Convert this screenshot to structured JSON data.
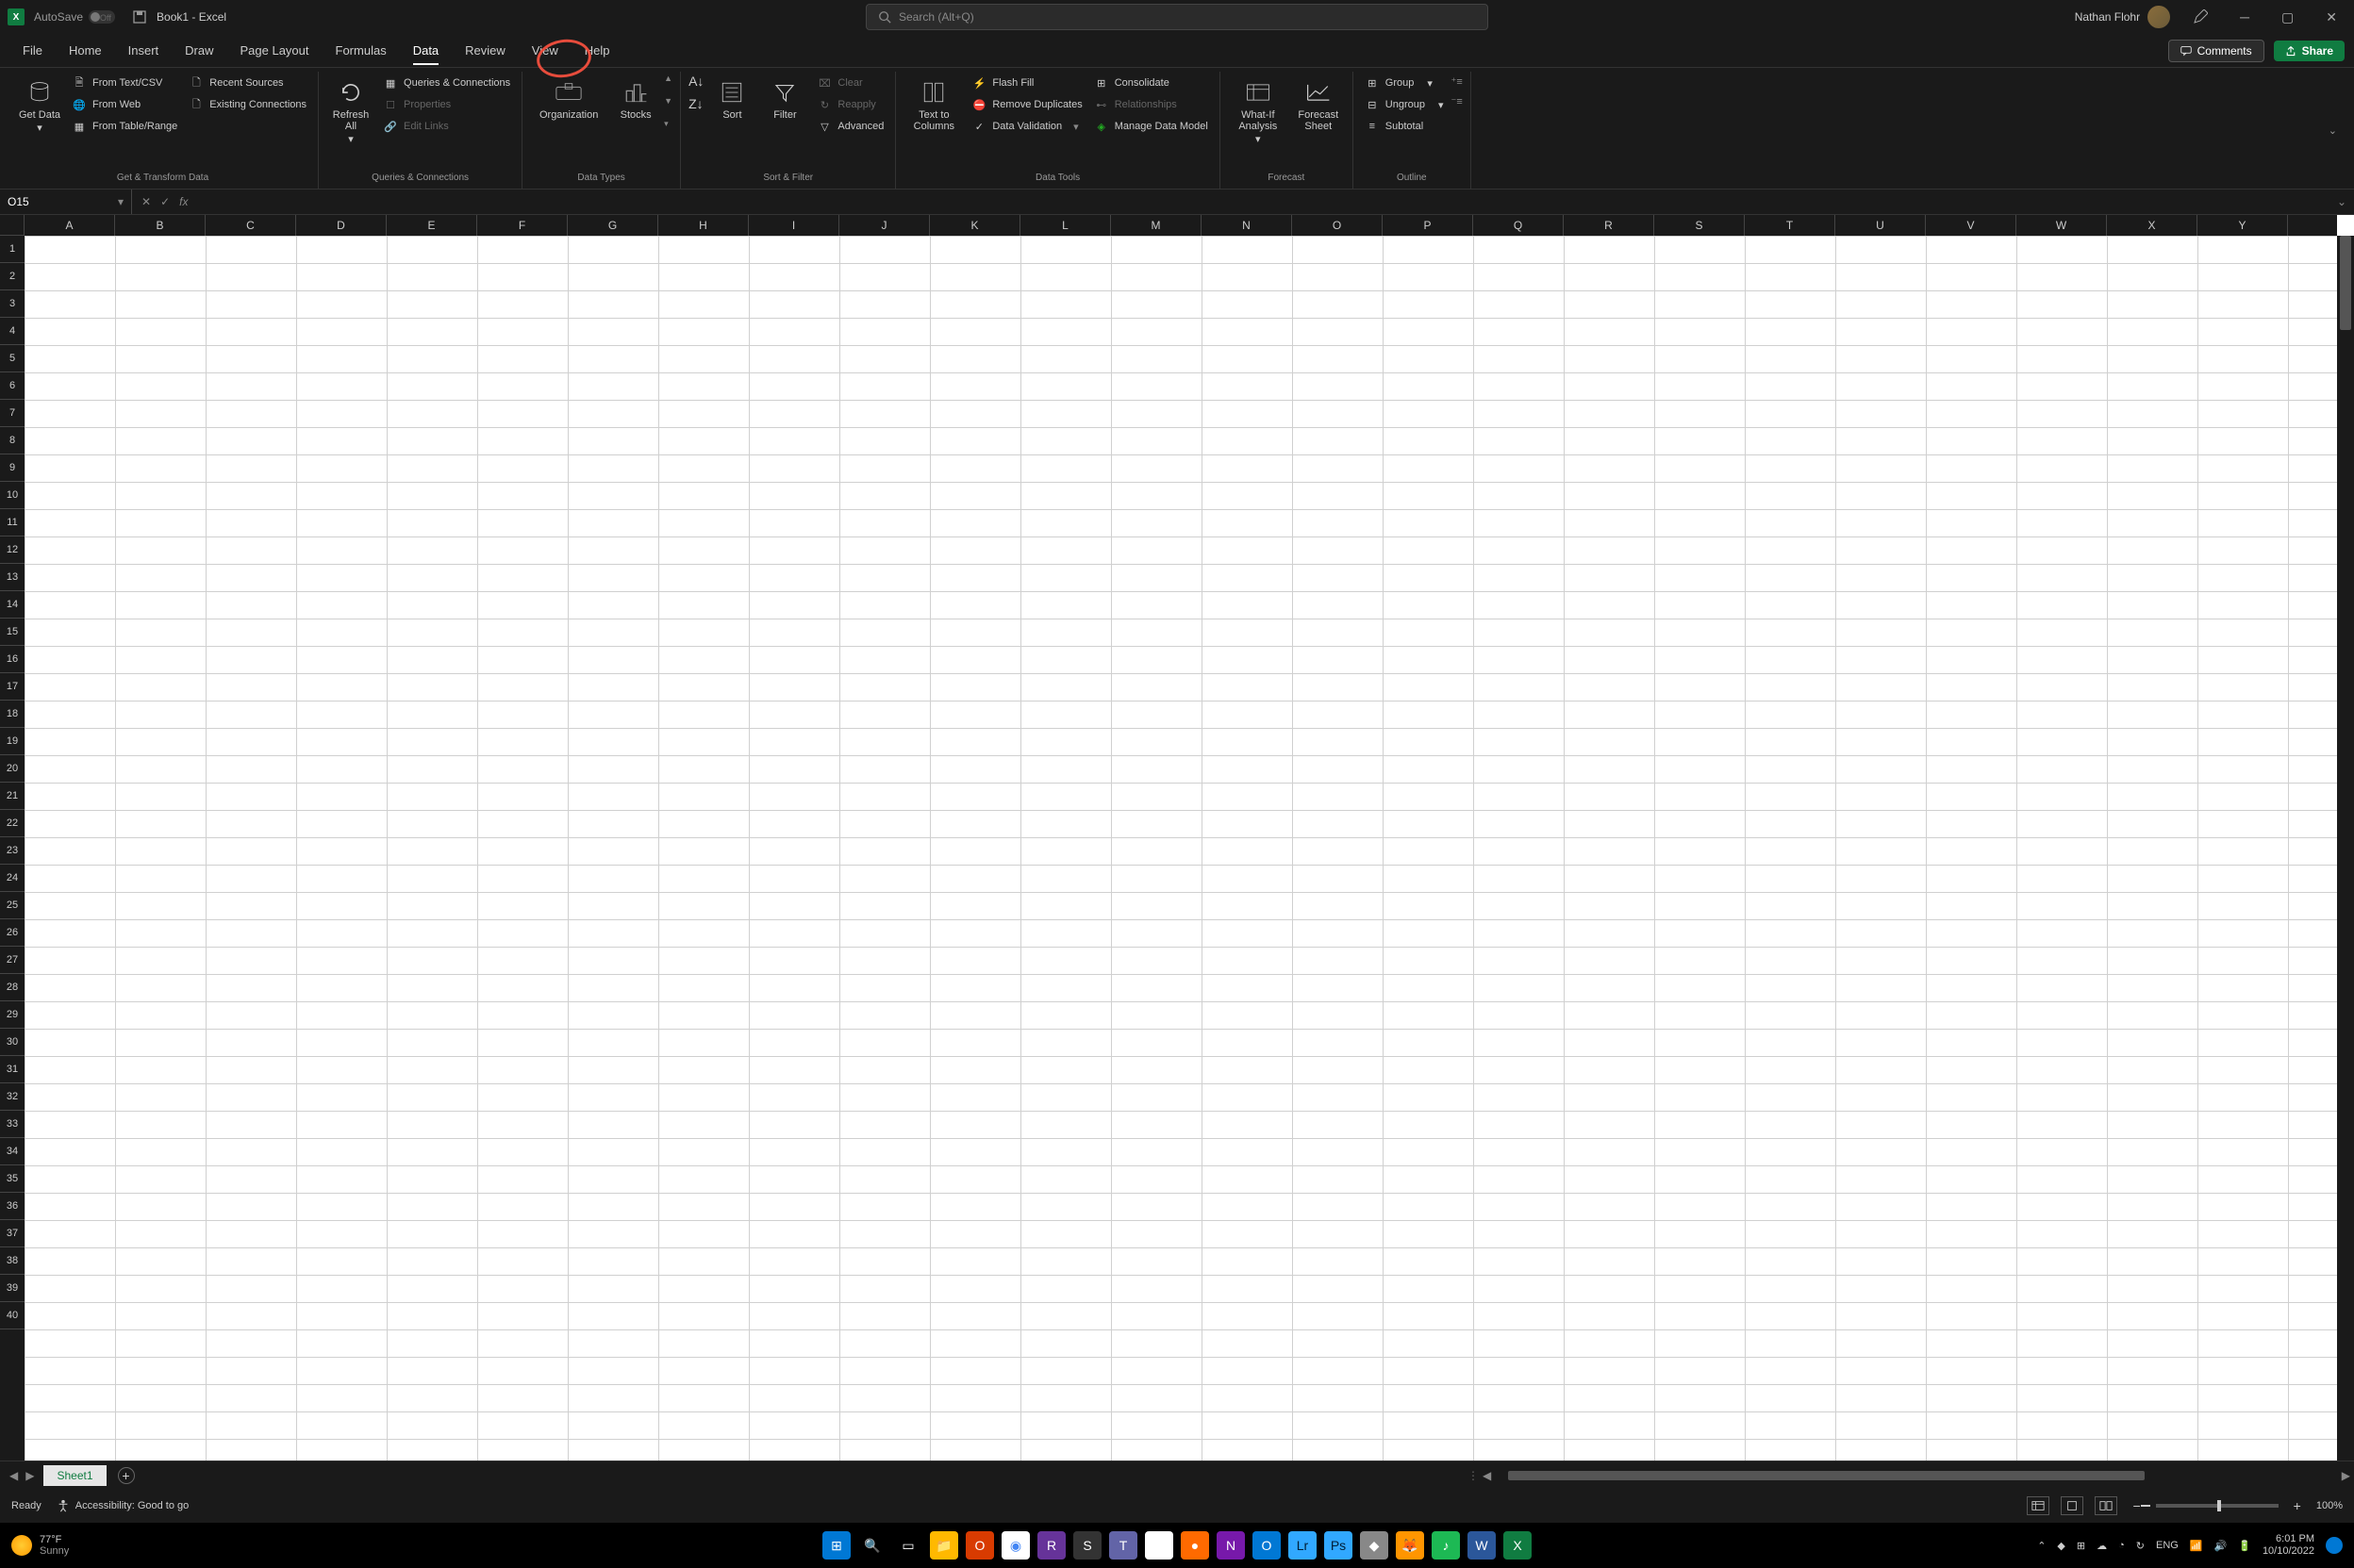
{
  "titlebar": {
    "autosave_label": "AutoSave",
    "autosave_state": "Off",
    "doc_title": "Book1 - Excel",
    "search_placeholder": "Search (Alt+Q)",
    "user_name": "Nathan Flohr"
  },
  "tabs": {
    "file": "File",
    "home": "Home",
    "insert": "Insert",
    "draw": "Draw",
    "page_layout": "Page Layout",
    "formulas": "Formulas",
    "data": "Data",
    "review": "Review",
    "view": "View",
    "help": "Help",
    "comments": "Comments",
    "share": "Share"
  },
  "ribbon": {
    "get_data": "Get Data",
    "from_text_csv": "From Text/CSV",
    "from_web": "From Web",
    "from_table_range": "From Table/Range",
    "recent_sources": "Recent Sources",
    "existing_connections": "Existing Connections",
    "group1_label": "Get & Transform Data",
    "refresh_all": "Refresh All",
    "queries_connections": "Queries & Connections",
    "properties": "Properties",
    "edit_links": "Edit Links",
    "group2_label": "Queries & Connections",
    "organization": "Organization",
    "stocks": "Stocks",
    "group3_label": "Data Types",
    "sort": "Sort",
    "filter": "Filter",
    "clear": "Clear",
    "reapply": "Reapply",
    "advanced": "Advanced",
    "group4_label": "Sort & Filter",
    "text_to_columns": "Text to Columns",
    "flash_fill": "Flash Fill",
    "remove_duplicates": "Remove Duplicates",
    "data_validation": "Data Validation",
    "consolidate": "Consolidate",
    "relationships": "Relationships",
    "manage_data_model": "Manage Data Model",
    "group5_label": "Data Tools",
    "what_if": "What-If Analysis",
    "forecast_sheet": "Forecast Sheet",
    "group6_label": "Forecast",
    "group": "Group",
    "ungroup": "Ungroup",
    "subtotal": "Subtotal",
    "group7_label": "Outline"
  },
  "formula_bar": {
    "name_box": "O15"
  },
  "grid": {
    "columns": [
      "A",
      "B",
      "C",
      "D",
      "E",
      "F",
      "G",
      "H",
      "I",
      "J",
      "K",
      "L",
      "M",
      "N",
      "O",
      "P",
      "Q",
      "R",
      "S",
      "T",
      "U",
      "V",
      "W",
      "X",
      "Y"
    ],
    "row_count": 40
  },
  "sheet": {
    "tab1": "Sheet1"
  },
  "status": {
    "ready": "Ready",
    "accessibility": "Accessibility: Good to go",
    "zoom": "100%"
  },
  "taskbar": {
    "temp": "77°F",
    "condition": "Sunny",
    "lang": "ENG",
    "time": "6:01 PM",
    "date": "10/10/2022"
  }
}
